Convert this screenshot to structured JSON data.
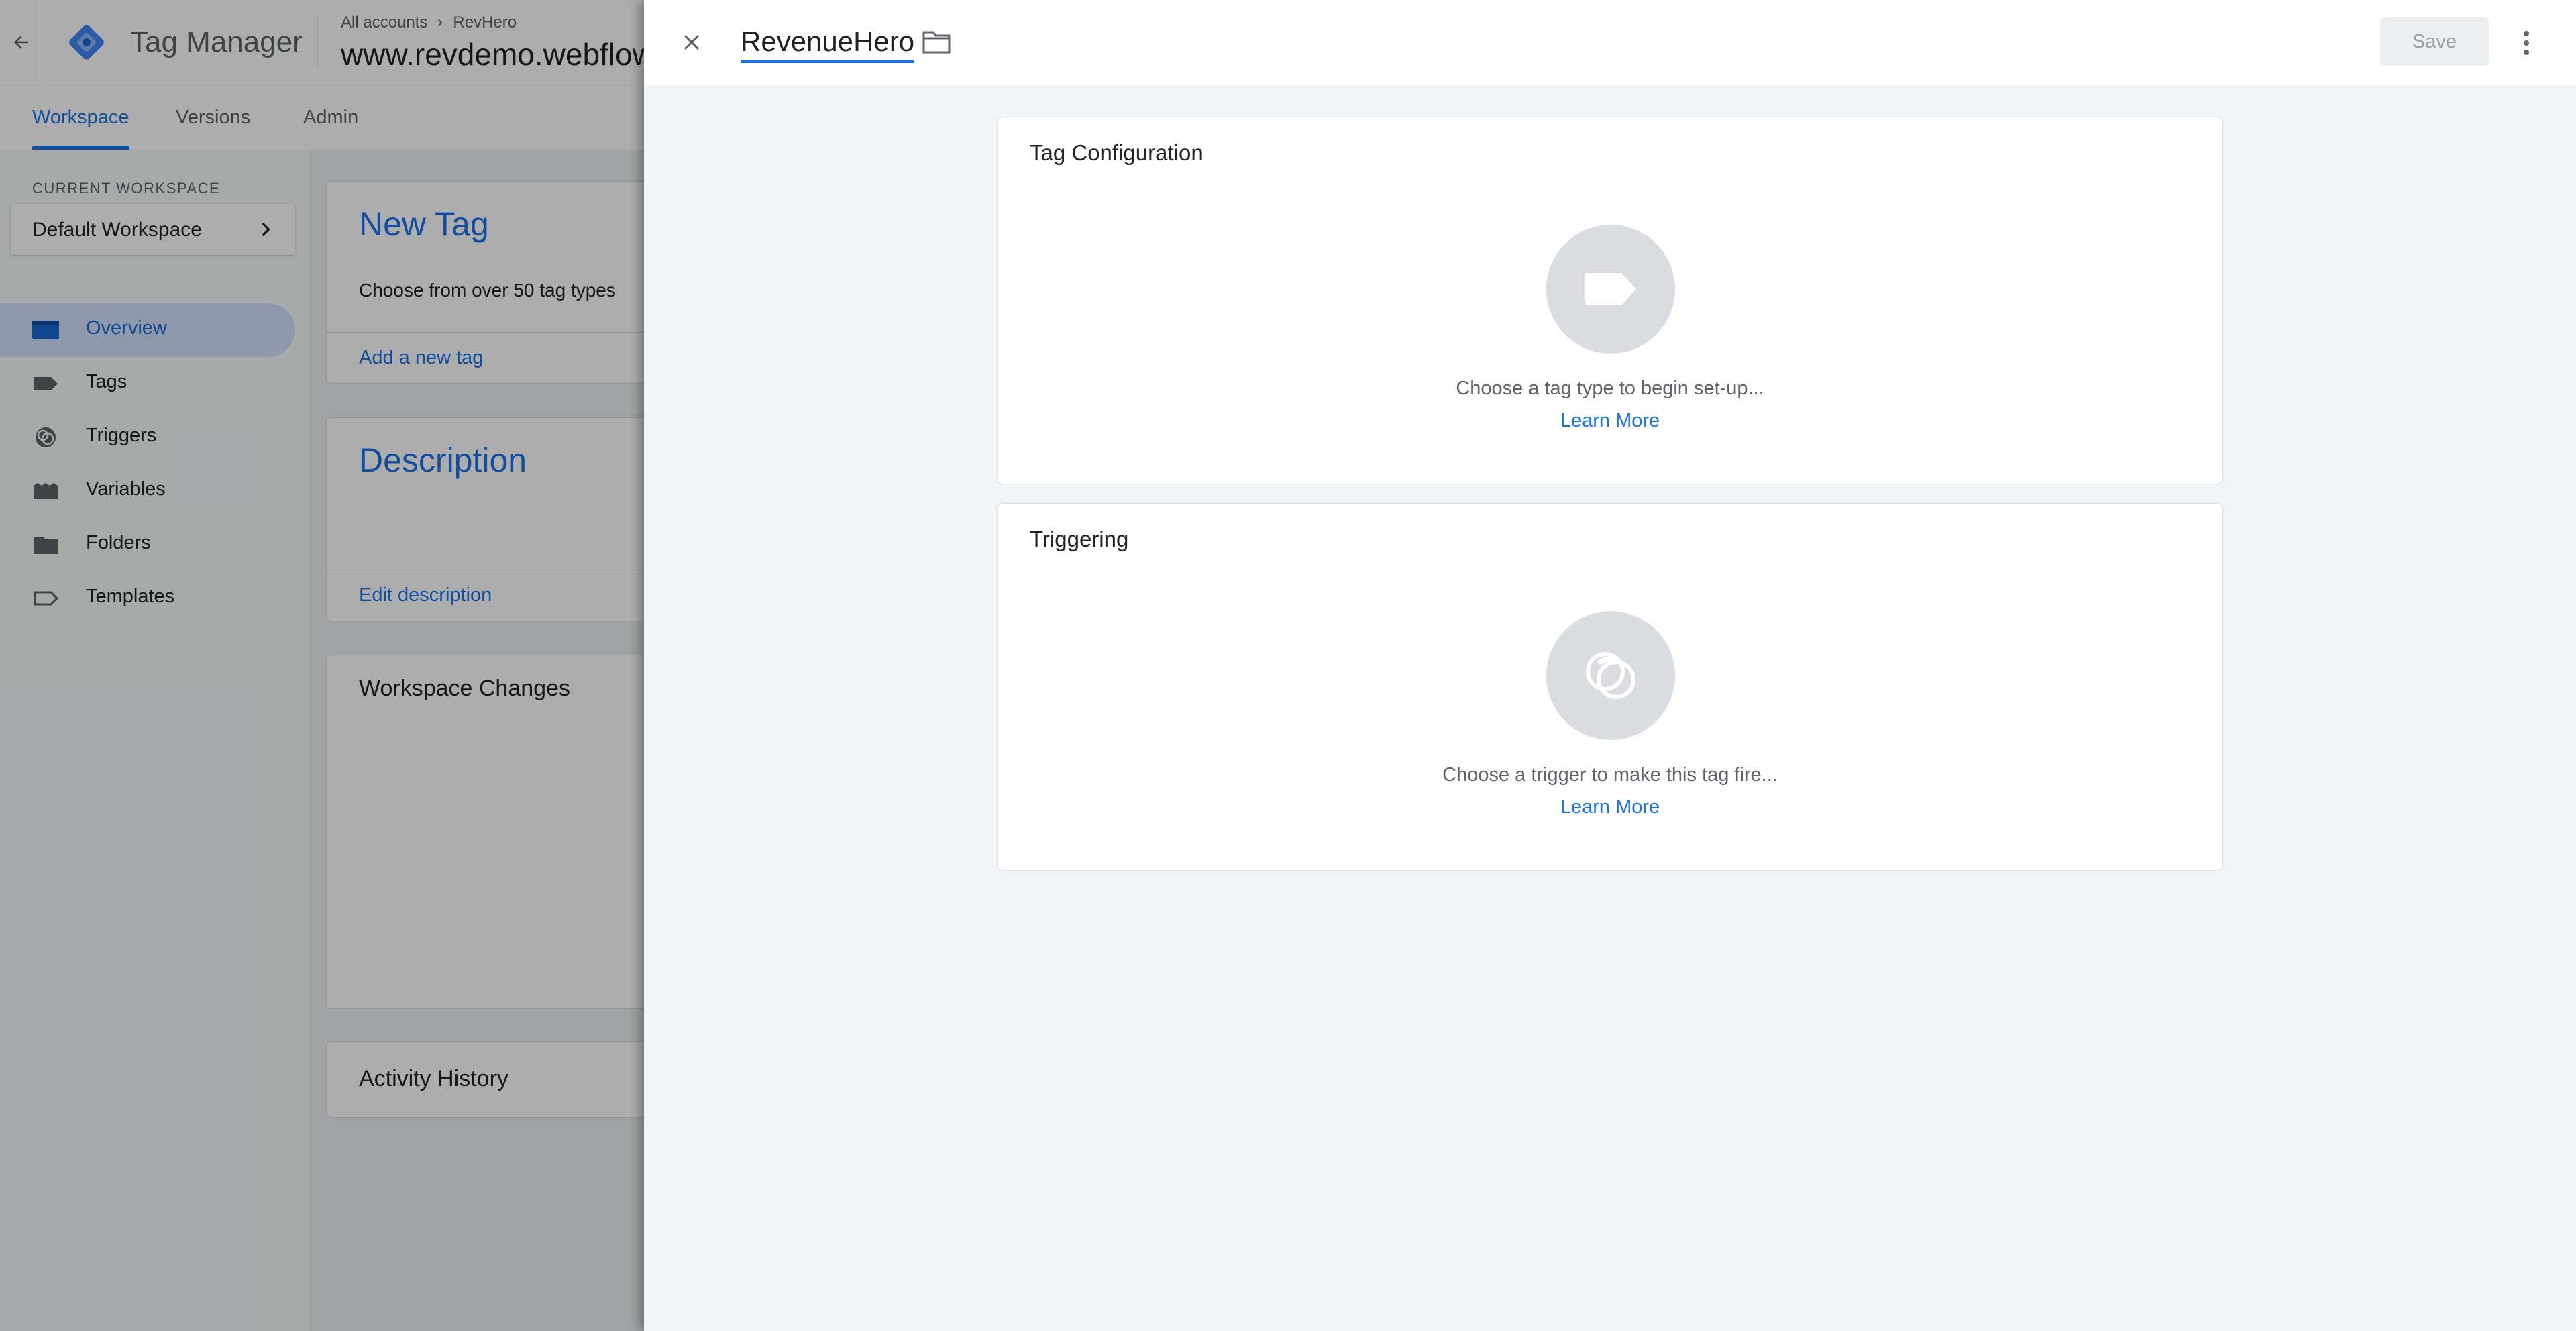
{
  "app": {
    "product_name": "Tag Manager",
    "breadcrumb": {
      "account": "All accounts",
      "container": "RevHero"
    },
    "container_name": "www.revdemo.webflow.io",
    "tabs": [
      "Workspace",
      "Versions",
      "Admin"
    ],
    "active_tab": "Workspace"
  },
  "sidebar": {
    "current_workspace_label": "CURRENT WORKSPACE",
    "workspace_name": "Default Workspace",
    "items": [
      {
        "label": "Overview",
        "icon": "overview-icon",
        "active": true
      },
      {
        "label": "Tags",
        "icon": "tag-icon",
        "active": false
      },
      {
        "label": "Triggers",
        "icon": "trigger-icon",
        "active": false
      },
      {
        "label": "Variables",
        "icon": "variables-icon",
        "active": false
      },
      {
        "label": "Folders",
        "icon": "folder-icon",
        "active": false
      },
      {
        "label": "Templates",
        "icon": "templates-icon",
        "active": false
      }
    ]
  },
  "overview": {
    "new_tag": {
      "title": "New Tag",
      "subtitle": "Choose from over 50 tag types",
      "link": "Add a new tag"
    },
    "description": {
      "title": "Description",
      "link": "Edit description"
    },
    "workspace_changes": {
      "title": "Workspace Changes"
    },
    "activity_history": {
      "title": "Activity History"
    }
  },
  "editor": {
    "tag_name": "RevenueHero",
    "save_label": "Save",
    "tag_configuration": {
      "title": "Tag Configuration",
      "hint": "Choose a tag type to begin set-up...",
      "link": "Learn More"
    },
    "triggering": {
      "title": "Triggering",
      "hint": "Choose a trigger to make this tag fire...",
      "link": "Learn More"
    }
  },
  "colors": {
    "accent": "#1a73e8",
    "active_nav_bg": "#d2e3fc",
    "panel_bg": "#f1f3f4",
    "placeholder_circle": "#dadce0"
  }
}
